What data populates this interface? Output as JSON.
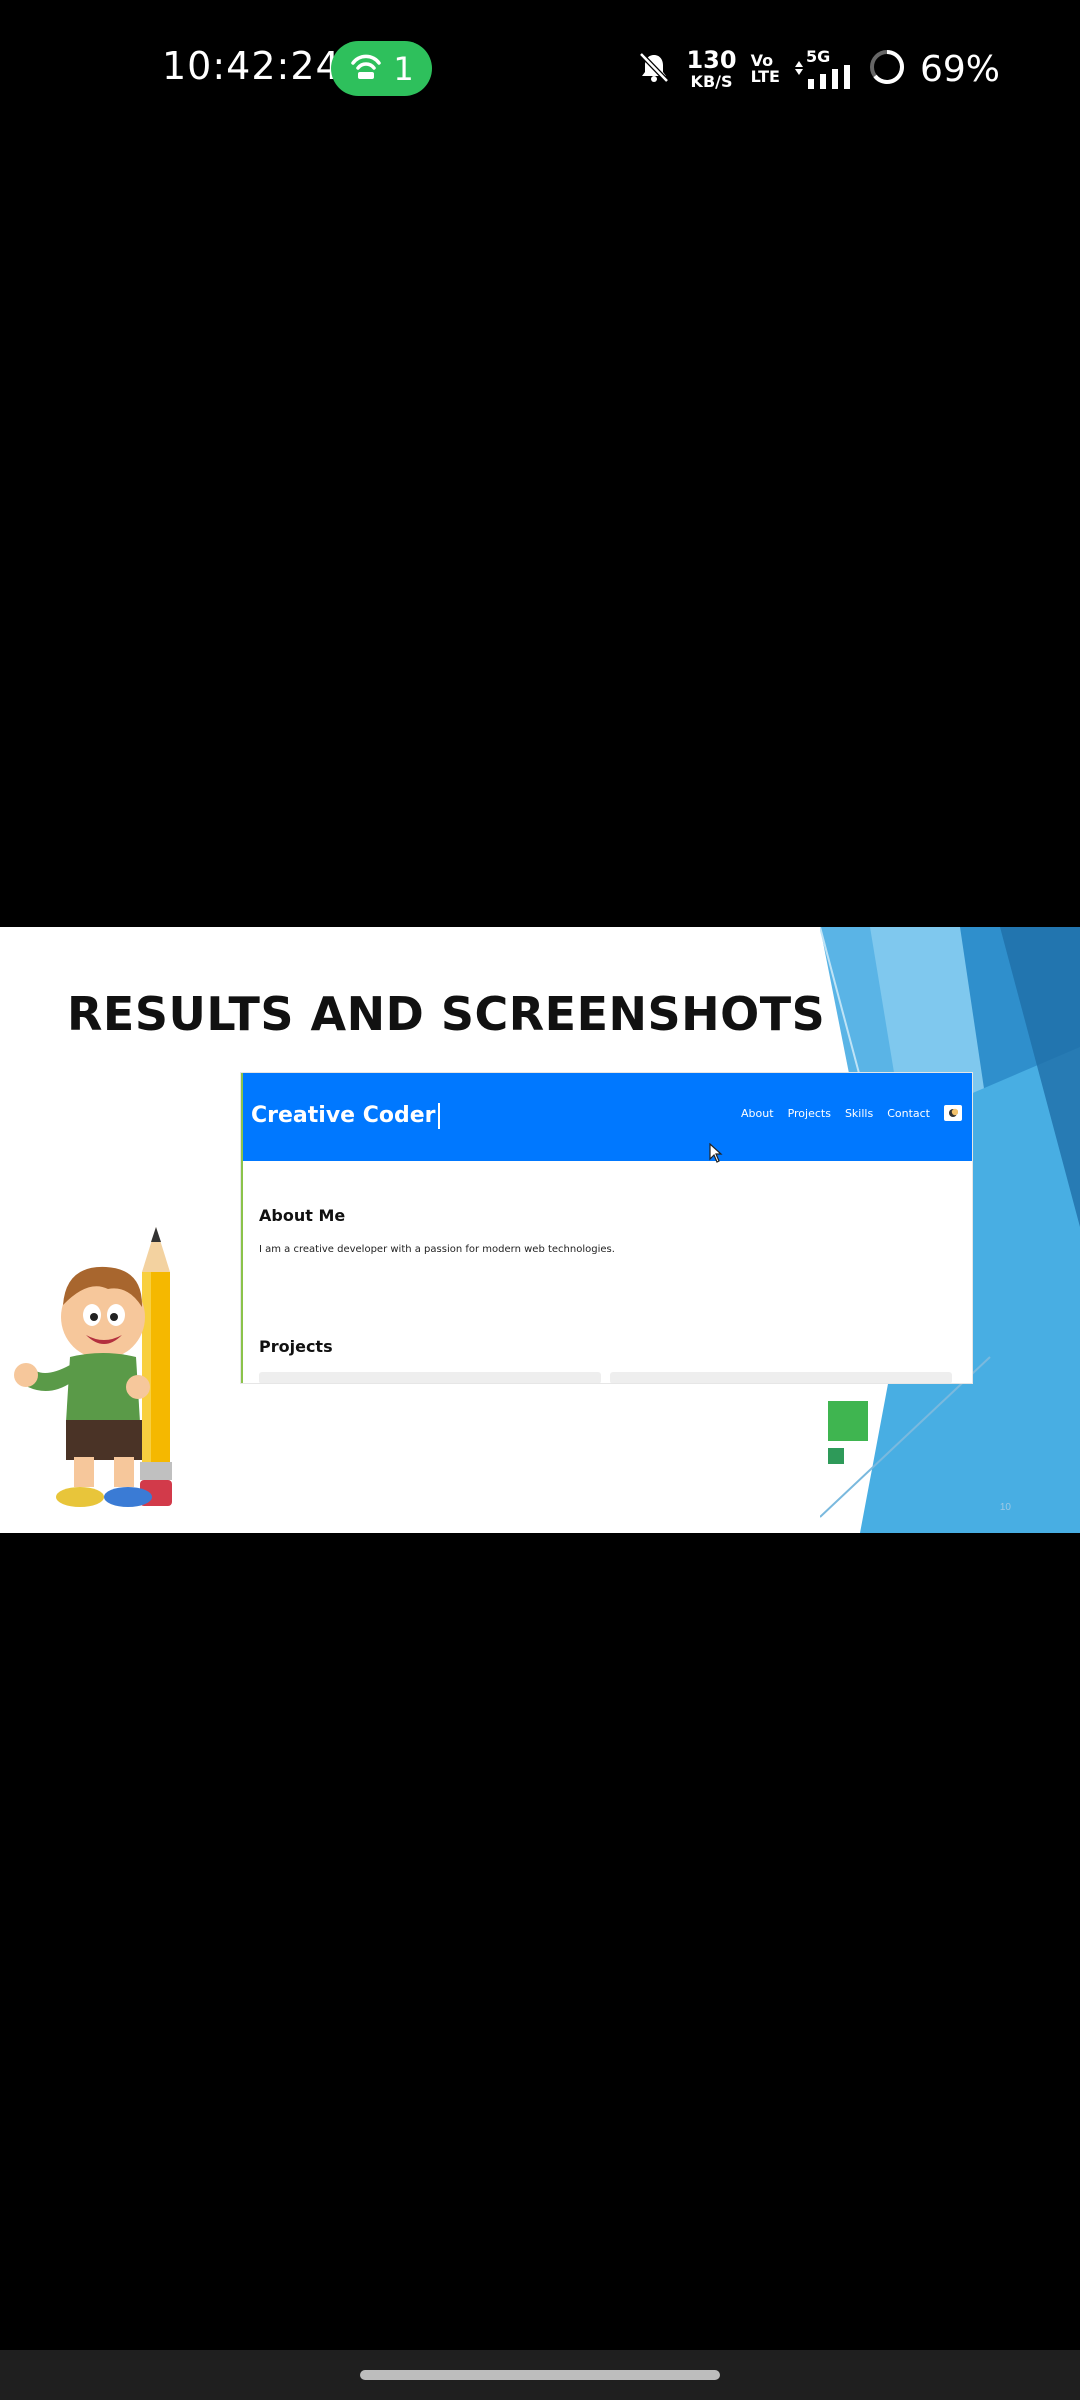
{
  "status_bar": {
    "time": "10:42:24",
    "hotspot_count": "1",
    "net_speed_value": "130",
    "net_speed_unit": "KB/S",
    "volte_top": "Vo",
    "volte_bottom": "LTE",
    "network_type": "5G",
    "battery_percent": "69%",
    "icons": [
      "hotspot-icon",
      "bell-muted-icon",
      "data-arrows-icon",
      "signal-bars-icon",
      "battery-ring-icon"
    ],
    "colors": {
      "hotspot_pill": "#2ec05c"
    }
  },
  "slide": {
    "title": "RESULTS AND SCREENSHOTS",
    "slide_number": "10",
    "colors": {
      "accent_blue": "#0078ff",
      "green": "#3fb550"
    }
  },
  "website": {
    "logo": "Creative Coder",
    "nav": [
      "About",
      "Projects",
      "Skills",
      "Contact"
    ],
    "about_title": "About Me",
    "about_text": "I am a creative developer with a passion for modern web technologies.",
    "projects_title": "Projects"
  }
}
